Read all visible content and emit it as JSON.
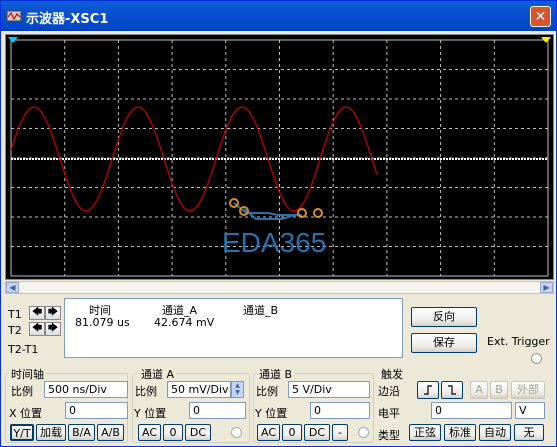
{
  "window": {
    "title": "示波器-XSC1",
    "close_label": "✕"
  },
  "screen": {
    "background": "#000000",
    "channel_a_color": "#cc0000",
    "channel_b_color": "#ffffff",
    "marker_t1_color": "#00ccff",
    "marker_t2_color": "#ffee00",
    "watermark": "EDA365"
  },
  "cursors": {
    "t1_label": "T1",
    "t2_label": "T2",
    "diff_label": "T2-T1"
  },
  "readout": {
    "headers": [
      "时间",
      "通道_A",
      "通道_B"
    ],
    "t1_row": [
      "81.079 us",
      "42.674 mV",
      ""
    ]
  },
  "buttons": {
    "reverse": "反向",
    "save": "保存"
  },
  "ext_trigger": {
    "label": "Ext. Trigger"
  },
  "timebase": {
    "title": "时间轴",
    "scale_label": "比例",
    "scale_value": "500 ns/Div",
    "xpos_label": "X 位置",
    "xpos_value": "0",
    "modes": [
      "Y/T",
      "加载",
      "B/A",
      "A/B"
    ]
  },
  "channel_a": {
    "title": "通道 A",
    "scale_label": "比例",
    "scale_value": "50 mV/Div",
    "ypos_label": "Y 位置",
    "ypos_value": "0",
    "coupling": [
      "AC",
      "0",
      "DC"
    ]
  },
  "channel_b": {
    "title": "通道 B",
    "scale_label": "比例",
    "scale_value": "5  V/Div",
    "ypos_label": "Y 位置",
    "ypos_value": "0",
    "coupling": [
      "AC",
      "0",
      "DC",
      "-"
    ]
  },
  "trigger": {
    "title": "触发",
    "edge_label": "边沿",
    "edge_buttons": [
      "A",
      "B",
      "外部"
    ],
    "level_label": "电平",
    "level_value": "0",
    "level_unit": "V",
    "type_label": "类型",
    "type_buttons": [
      "正弦",
      "标准",
      "自动",
      "无"
    ]
  }
}
